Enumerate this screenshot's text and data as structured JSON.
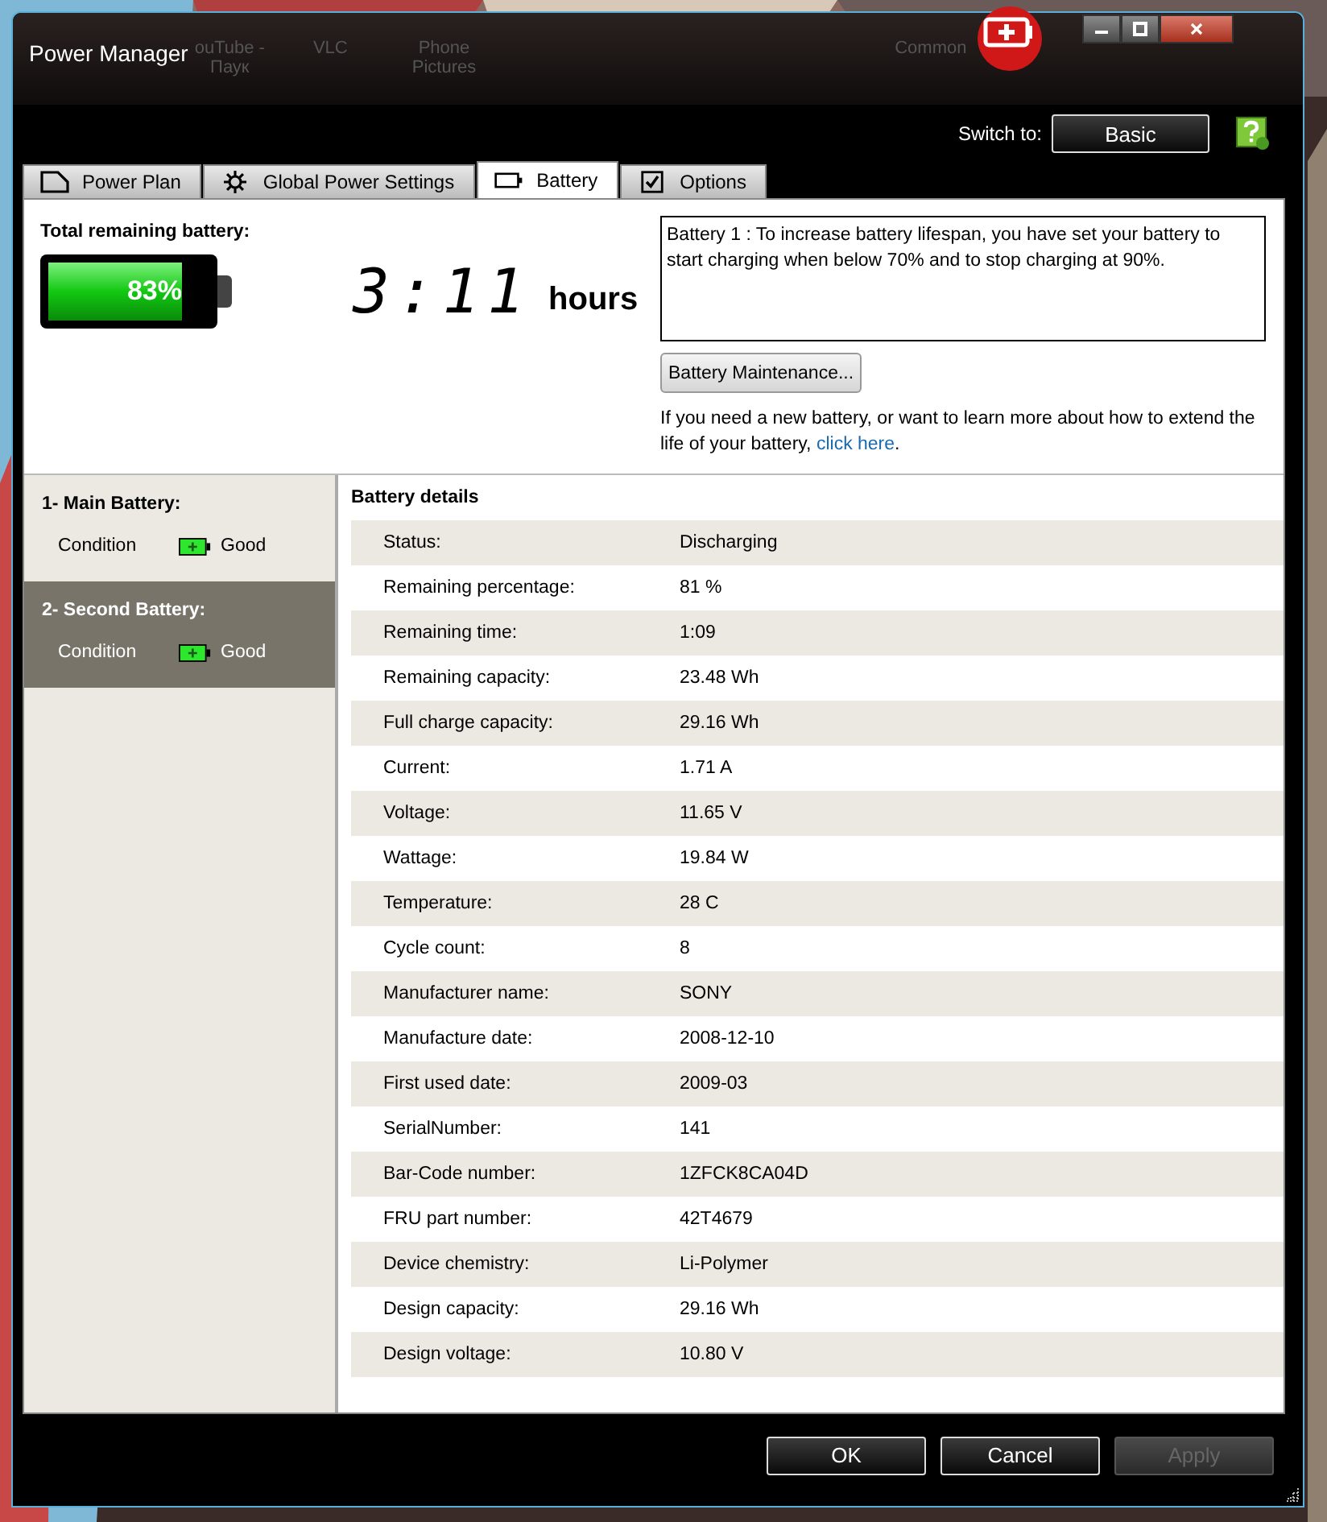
{
  "desktop_labels": [
    {
      "text": "ouTube -\nПаук"
    },
    {
      "text": "VLC"
    },
    {
      "text": "Phone\nPictures"
    },
    {
      "text": "Common"
    }
  ],
  "window": {
    "title": "Power Manager"
  },
  "switch": {
    "label": "Switch to:",
    "button": "Basic"
  },
  "tabs": [
    {
      "label": "Power Plan",
      "selected": false
    },
    {
      "label": "Global Power Settings",
      "selected": false
    },
    {
      "label": "Battery",
      "selected": true
    },
    {
      "label": "Options",
      "selected": false
    }
  ],
  "summary": {
    "title": "Total remaining battery:",
    "percent": "83%",
    "level": 0.83,
    "time": "3:11",
    "time_unit": "hours"
  },
  "notice": "Battery 1 : To increase battery lifespan, you have set your battery to start charging when below 70% and to stop charging at 90%.",
  "maintenance_button": "Battery Maintenance...",
  "info": {
    "text": "If you need a new battery, or want to learn more about how to extend the life of your battery, ",
    "link": "click here",
    "after": "."
  },
  "batteries": [
    {
      "name": "1- Main Battery:",
      "condition_label": "Condition",
      "condition": "Good",
      "selected": false
    },
    {
      "name": "2- Second Battery:",
      "condition_label": "Condition",
      "condition": "Good",
      "selected": true
    }
  ],
  "details": {
    "title": "Battery details",
    "rows": [
      {
        "label": "Status:",
        "value": "Discharging"
      },
      {
        "label": "Remaining percentage:",
        "value": "81 %"
      },
      {
        "label": "Remaining time:",
        "value": "1:09"
      },
      {
        "label": "Remaining capacity:",
        "value": "23.48 Wh"
      },
      {
        "label": "Full charge capacity:",
        "value": "29.16 Wh"
      },
      {
        "label": "Current:",
        "value": "1.71 A"
      },
      {
        "label": "Voltage:",
        "value": "11.65 V"
      },
      {
        "label": "Wattage:",
        "value": "19.84 W"
      },
      {
        "label": "Temperature:",
        "value": "28 C"
      },
      {
        "label": "Cycle count:",
        "value": "8"
      },
      {
        "label": "Manufacturer name:",
        "value": "SONY"
      },
      {
        "label": "Manufacture date:",
        "value": "2008-12-10"
      },
      {
        "label": "First used date:",
        "value": "2009-03"
      },
      {
        "label": "SerialNumber:",
        "value": "141"
      },
      {
        "label": "Bar-Code number:",
        "value": "1ZFCK8CA04D"
      },
      {
        "label": "FRU part number:",
        "value": "42T4679"
      },
      {
        "label": "Device chemistry:",
        "value": "Li-Polymer"
      },
      {
        "label": "Design capacity:",
        "value": "29.16 Wh"
      },
      {
        "label": "Design voltage:",
        "value": "10.80 V"
      }
    ]
  },
  "buttons": [
    {
      "label": "OK",
      "disabled": false
    },
    {
      "label": "Cancel",
      "disabled": false
    },
    {
      "label": "Apply",
      "disabled": true
    }
  ]
}
